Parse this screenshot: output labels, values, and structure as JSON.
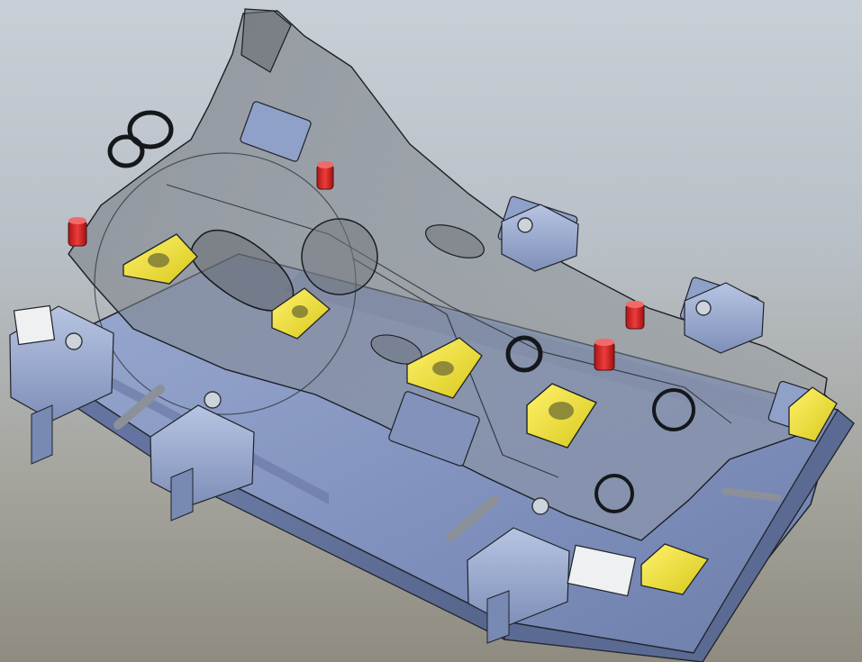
{
  "viewport": {
    "background_top": "#c9cfd6",
    "background_bottom": "#8f8b80"
  },
  "colors": {
    "base_plate": "#7f90bd",
    "base_plate_side": "#5f6f98",
    "fixture_blue": "#8fa0c9",
    "fixture_blue_dark": "#5f6f98",
    "transparent_part": "#8a8f96",
    "locator_yellow": "#f2e83a",
    "pin_red": "#d92a2a",
    "clamp_gray": "#9aa0aa",
    "edge_dark": "#1f2328"
  },
  "icons": {
    "main_base_plate": "base-plate-shape",
    "welded_frame_part": "transparent-part-shape",
    "clamp_units": "toggle-clamp-shape",
    "locating_blocks": "locator-block-shape",
    "locating_pins": "locating-pin-shape"
  }
}
